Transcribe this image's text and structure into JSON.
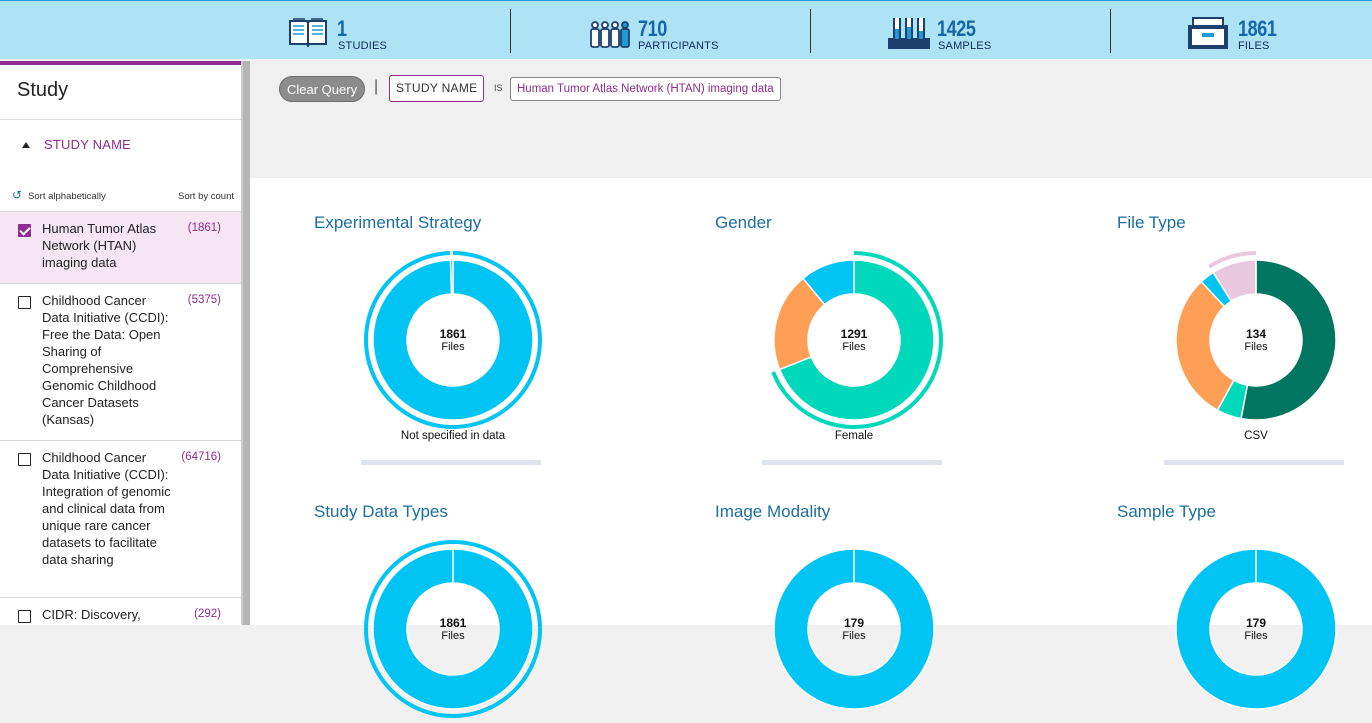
{
  "stats": [
    {
      "icon": "book-icon",
      "value": "1",
      "label": "STUDIES"
    },
    {
      "icon": "participants-icon",
      "value": "710",
      "label": "PARTICIPANTS"
    },
    {
      "icon": "test-tubes-icon",
      "value": "1425",
      "label": "SAMPLES"
    },
    {
      "icon": "file-box-icon",
      "value": "1861",
      "label": "FILES"
    }
  ],
  "sidebar": {
    "title": "Study",
    "facet_label": "STUDY NAME",
    "sort_alpha": "Sort alphabetically",
    "sort_count": "Sort by count",
    "items": [
      {
        "label": "Human Tumor Atlas Network (HTAN) imaging data",
        "count": "(1861)",
        "checked": true
      },
      {
        "label": "Childhood Cancer Data Initiative (CCDI): Free the Data: Open Sharing of Comprehensive Genomic Childhood Cancer Datasets (Kansas)",
        "count": "(5375)",
        "checked": false
      },
      {
        "label": "Childhood Cancer Data Initiative (CCDI): Integration of genomic and clinical data from unique rare cancer datasets to facilitate data sharing",
        "count": "(64716)",
        "checked": false
      },
      {
        "label": "CIDR: Discovery,",
        "count": "(292)",
        "checked": false
      }
    ]
  },
  "query": {
    "clear_label": "Clear Query",
    "separator": "|",
    "field": "STUDY NAME",
    "operator": "IS",
    "value": "Human Tumor Atlas Network (HTAN) imaging data"
  },
  "colors": {
    "accent": "#8e2c8f",
    "blue": "#00c4f4",
    "teal": "#00d8bc",
    "orange": "#ff9f55",
    "darkgreen": "#00755f",
    "lilac": "#e8c8dc"
  },
  "chart_data": [
    {
      "type": "pie",
      "title": "Experimental Strategy",
      "center_value": "1861",
      "center_unit": "Files",
      "hover_label": "Not specified in data",
      "slices": [
        {
          "value": 99.5,
          "color": "#00c4f4",
          "active": true
        },
        {
          "value": 0.5,
          "color": "#00c4f4"
        }
      ]
    },
    {
      "type": "pie",
      "title": "Gender",
      "center_value": "1291",
      "center_unit": "Files",
      "hover_label": "Female",
      "slices": [
        {
          "value": 69,
          "color": "#00d8bc",
          "active": true
        },
        {
          "value": 20,
          "color": "#ff9f55"
        },
        {
          "value": 11,
          "color": "#00c4f4"
        }
      ]
    },
    {
      "type": "pie",
      "title": "File Type",
      "center_value": "134",
      "center_unit": "Files",
      "hover_label": "CSV",
      "slices": [
        {
          "value": 53,
          "color": "#00755f"
        },
        {
          "value": 5,
          "color": "#00d8bc"
        },
        {
          "value": 30,
          "color": "#ff9f55"
        },
        {
          "value": 3,
          "color": "#00c4f4"
        },
        {
          "value": 9,
          "color": "#e8c8dc",
          "active": true
        }
      ]
    },
    {
      "type": "pie",
      "title": "Study Data Types",
      "center_value": "1861",
      "center_unit": "Files",
      "hover_label": "",
      "slices": [
        {
          "value": 100,
          "color": "#00c4f4",
          "active": true
        }
      ]
    },
    {
      "type": "pie",
      "title": "Image Modality",
      "center_value": "179",
      "center_unit": "Files",
      "hover_label": "",
      "slices": [
        {
          "value": 100,
          "color": "#00c4f4"
        }
      ]
    },
    {
      "type": "pie",
      "title": "Sample Type",
      "center_value": "179",
      "center_unit": "Files",
      "hover_label": "",
      "slices": [
        {
          "value": 100,
          "color": "#00c4f4"
        }
      ]
    }
  ]
}
